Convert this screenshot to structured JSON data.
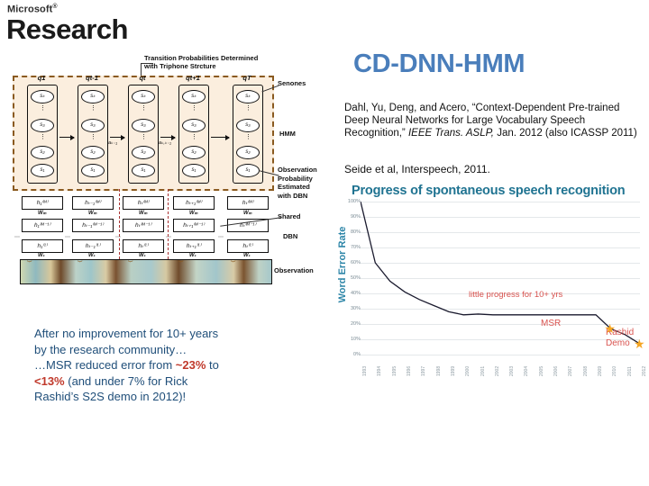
{
  "logo": {
    "company": "Microsoft",
    "trademark": "®",
    "division": "Research"
  },
  "slide": {
    "title": "CD-DNN-HMM",
    "citation_part1": "Dahl, Yu, Deng, and Acero, “Context-Dependent Pre-trained Deep Neural Networks for Large Vocabulary Speech Recognition,” ",
    "citation_italic": "IEEE Trans. ASLP,",
    "citation_part2": " Jan. 2012 (also ICASSP 2011)",
    "citation2": "Seide et al, Interspeech, 2011."
  },
  "conclusion": {
    "line1": "After no improvement for 10+ years",
    "line2": "by the research community…",
    "line3_pre": "…MSR reduced error from ",
    "line3_hl": "~23%",
    "line3_post": " to",
    "line4_hl": "<13%",
    "line4_post": " (and under 7% for Rick",
    "line5": "Rashid’s S2S demo in 2012)!"
  },
  "chart_data": {
    "type": "line",
    "title": "Progress of spontaneous speech recognition",
    "xlabel": "",
    "ylabel": "Word Error Rate",
    "ylim": [
      0,
      100
    ],
    "ytick_labels": [
      "100%",
      "90%",
      "80%",
      "70%",
      "60%",
      "50%",
      "40%",
      "30%",
      "20%",
      "10%",
      "0%"
    ],
    "ytick_values": [
      100,
      90,
      80,
      70,
      60,
      50,
      40,
      30,
      20,
      10,
      0
    ],
    "grid": true,
    "legend": "none",
    "categories": [
      "1993",
      "1994",
      "1995",
      "1996",
      "1997",
      "1998",
      "1999",
      "2000",
      "2001",
      "2002",
      "2003",
      "2004",
      "2005",
      "2006",
      "2007",
      "2008",
      "2009",
      "2010",
      "2011",
      "2012"
    ],
    "series": [
      {
        "name": "Word Error Rate",
        "values": [
          100,
          60,
          48,
          41,
          36,
          32,
          28,
          26,
          26.5,
          26,
          26,
          26,
          26,
          26,
          26,
          26,
          26,
          17,
          13,
          7
        ]
      }
    ],
    "annotations": [
      {
        "name": "little-progress",
        "text": "little progress for 10+ yrs",
        "color": "#d9534f"
      },
      {
        "name": "msr-marker",
        "text": "MSR",
        "color": "#d9534f",
        "marker": "star",
        "marker_color": "#f5a623",
        "x": "2010",
        "y": 17
      },
      {
        "name": "rashid-demo-marker",
        "text": "Rashid\nDemo",
        "text_line1": "Rashid",
        "text_line2": "Demo",
        "color": "#d9534f",
        "marker": "star",
        "marker_color": "#f5a623",
        "x": "2012",
        "y": 7
      }
    ],
    "line_color": "#1a1a2e",
    "grid_color": "#e4e8ea"
  },
  "diagram": {
    "name": "cd-dnn-hmm-architecture",
    "transition_label_line1": "Transition Probabilities Determined",
    "transition_label_line2": "with Triphone Strcture",
    "phone_labels": [
      "q1",
      "qt-1",
      "qt",
      "qt+1",
      "qT"
    ],
    "senone_top": "sₖ",
    "senone_mid": "s₃",
    "senone_low": "s₂",
    "senone_bottom": "s₁",
    "transition_a1": "aₖ₋₁",
    "transition_a2": "aₖ,ₖ₋₁",
    "hidden_top": [
      "h₁⁽ᴹ⁾",
      "hₜ₋₁⁽ᴹ⁾",
      "hₜ⁽ᴹ⁾",
      "hₜ₊₁⁽ᴹ⁾",
      "hₜ⁽ᴹ⁾"
    ],
    "hidden_upper": [
      "h₁⁽ᴹ⁻¹⁾",
      "hₜ₋₁⁽ᴹ⁻¹⁾",
      "hₜ⁽ᴹ⁻¹⁾",
      "hₜ₊₁⁽ᴹ⁻¹⁾",
      "hₜ⁽ᴹ⁻¹⁾"
    ],
    "hidden_first": [
      "h₁⁽¹⁾",
      "hₜ₋₁⁽¹⁾",
      "hₜ⁽¹⁾",
      "hₜ₊₁⁽¹⁾",
      "hₜ⁽¹⁾"
    ],
    "visible": [
      "v₁",
      "vₜ₋₁",
      "vₜ",
      "vₜ₊₁",
      "vₜ"
    ],
    "weight_top": "Wₘ",
    "weight_first": "W₁",
    "side_labels": {
      "senones": "Senones",
      "hmm": "HMM",
      "obs_prob": "Observation\nProbability\nEstimated\nwith DBN",
      "obs_prob_l1": "Observation",
      "obs_prob_l2": "Probability",
      "obs_prob_l3": "Estimated",
      "obs_prob_l4": "with DBN",
      "shared": "Shared",
      "dbn": "DBN",
      "observation": "Observation"
    }
  },
  "colors": {
    "title_blue": "#4a7ebb",
    "chart_teal": "#1f7391",
    "conclusion_blue": "#1f4e79",
    "highlight_red": "#c0392b",
    "annot_red": "#d9534f",
    "star_orange": "#f5a623",
    "hmm_fill": "#fbeede",
    "hmm_border": "#8a5a20"
  }
}
